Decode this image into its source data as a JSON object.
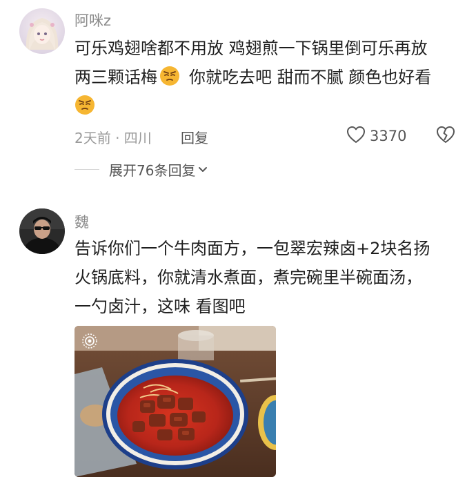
{
  "comments": [
    {
      "username": "阿咪z",
      "lines": [
        "可乐鸡翅啥都不用放 鸡翅煎一下锅里倒可乐再放",
        "两三颗话梅",
        "你就吃去吧 甜而不腻 颜色也好看"
      ],
      "time": "2天前 · 四川",
      "reply_label": "回复",
      "like_count": "3370",
      "expand_label": "展开76条回复"
    },
    {
      "username": "魏",
      "lines": [
        "告诉你们一个牛肉面方，一包翠宏辣卤+2块名扬",
        "火锅底料，你就清水煮面，煮完碗里半碗面汤，",
        "一勺卤汁，这味 看图吧"
      ]
    }
  ],
  "icons": {
    "emoji": "smirk-emoji-icon",
    "like": "heart-outline-icon",
    "dislike": "broken-heart-icon",
    "expand": "chevron-down-icon",
    "live_photo": "live-photo-icon"
  },
  "colors": {
    "primary_text": "#1e1e1e",
    "secondary_text": "#9a9a9a",
    "action_text": "#555555",
    "emoji_yellow": "#f6b632"
  }
}
